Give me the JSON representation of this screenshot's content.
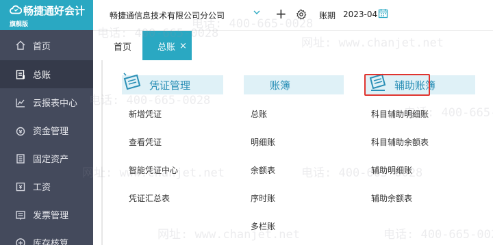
{
  "brand": {
    "name": "畅捷通好会计",
    "edition": "旗舰版"
  },
  "sidebar": {
    "items": [
      {
        "label": "首页",
        "icon": "home-icon"
      },
      {
        "label": "总账",
        "icon": "ledger-icon"
      },
      {
        "label": "云报表中心",
        "icon": "chart-icon"
      },
      {
        "label": "资金管理",
        "icon": "money-icon"
      },
      {
        "label": "固定资产",
        "icon": "asset-icon"
      },
      {
        "label": "工资",
        "icon": "salary-icon"
      },
      {
        "label": "发票管理",
        "icon": "invoice-icon"
      },
      {
        "label": "库存核算",
        "icon": "inventory-icon"
      }
    ]
  },
  "topbar": {
    "company": "畅捷通信息技术有限公司分公司",
    "period_label": "账期",
    "period_value": "2023-04"
  },
  "tabs": {
    "home": "首页",
    "active": "总账",
    "close": "×"
  },
  "sections": [
    {
      "title": "凭证管理",
      "links": [
        "新增凭证",
        "查看凭证",
        "智能凭证中心",
        "凭证汇总表"
      ]
    },
    {
      "title": "账簿",
      "links": [
        "总账",
        "明细账",
        "余额表",
        "序时账",
        "多栏账"
      ]
    },
    {
      "title": "辅助账簿",
      "links": [
        "科目辅助明细账",
        "科目辅助余额表",
        "辅助明细账",
        "辅助余额表"
      ]
    }
  ],
  "watermark": {
    "phone": "电话: 400-665-0028",
    "site": "网址: www.chanjet.net"
  },
  "colors": {
    "accent": "#2aa8c2",
    "sidebar": "#444a5c",
    "highlight": "#e0332e",
    "section_bg": "#dff1f7",
    "section_text": "#2a8fb6"
  }
}
